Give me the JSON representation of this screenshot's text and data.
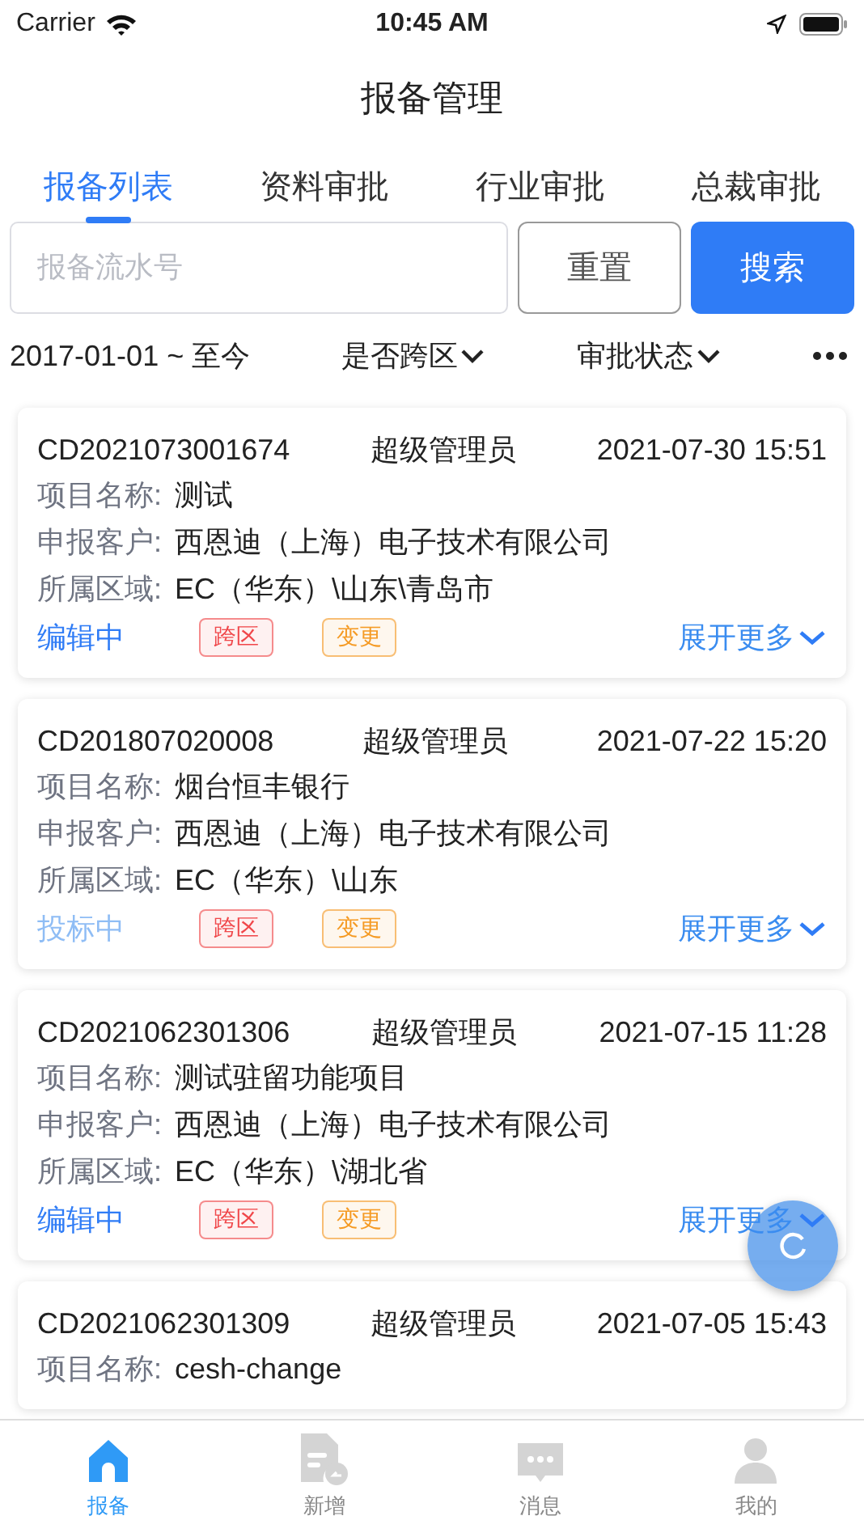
{
  "status_bar": {
    "carrier": "Carrier",
    "time": "10:45 AM"
  },
  "title": "报备管理",
  "tabs": [
    {
      "label": "报备列表",
      "selected": true
    },
    {
      "label": "资料审批",
      "selected": false
    },
    {
      "label": "行业审批",
      "selected": false
    },
    {
      "label": "总裁审批",
      "selected": false
    }
  ],
  "search": {
    "placeholder": "报备流水号",
    "reset": "重置",
    "submit": "搜索"
  },
  "filters": {
    "date_range": "2017-01-01 ~ 至今",
    "cross_region": "是否跨区",
    "approval_status": "审批状态"
  },
  "cards": [
    {
      "serial": "CD2021073001674",
      "user": "超级管理员",
      "time": "2021-07-30 15:51",
      "fields": [
        {
          "label": "项目名称:",
          "value": "测试"
        },
        {
          "label": "申报客户:",
          "value": "西恩迪（上海）电子技术有限公司"
        },
        {
          "label": "所属区域:",
          "value": "EC（华东）\\山东\\青岛市"
        }
      ],
      "status": {
        "text": "编辑中",
        "color": "#2f7cf6"
      },
      "tags": [
        {
          "text": "跨区",
          "color": "#f0474a"
        },
        {
          "text": "变更",
          "color": "#f59a23"
        }
      ],
      "expand": "展开更多"
    },
    {
      "serial": "CD201807020008",
      "user": "超级管理员",
      "time": "2021-07-22 15:20",
      "fields": [
        {
          "label": "项目名称:",
          "value": "烟台恒丰银行"
        },
        {
          "label": "申报客户:",
          "value": "西恩迪（上海）电子技术有限公司"
        },
        {
          "label": "所属区域:",
          "value": "EC（华东）\\山东"
        }
      ],
      "status": {
        "text": "投标中",
        "color": "#8fbdf5"
      },
      "tags": [
        {
          "text": "跨区",
          "color": "#f0474a"
        },
        {
          "text": "变更",
          "color": "#f59a23"
        }
      ],
      "expand": "展开更多"
    },
    {
      "serial": "CD2021062301306",
      "user": "超级管理员",
      "time": "2021-07-15 11:28",
      "fields": [
        {
          "label": "项目名称:",
          "value": "测试驻留功能项目"
        },
        {
          "label": "申报客户:",
          "value": "西恩迪（上海）电子技术有限公司"
        },
        {
          "label": "所属区域:",
          "value": "EC（华东）\\湖北省"
        }
      ],
      "status": {
        "text": "编辑中",
        "color": "#2f7cf6"
      },
      "tags": [
        {
          "text": "跨区",
          "color": "#f0474a"
        },
        {
          "text": "变更",
          "color": "#f59a23"
        }
      ],
      "expand": "展开更多"
    },
    {
      "serial": "CD2021062301309",
      "user": "超级管理员",
      "time": "2021-07-05 15:43",
      "fields": [
        {
          "label": "项目名称:",
          "value": "cesh-change"
        }
      ]
    }
  ],
  "bottom_tabs": [
    {
      "label": "报备",
      "kind": "home",
      "selected": true
    },
    {
      "label": "新增",
      "kind": "add",
      "selected": false
    },
    {
      "label": "消息",
      "kind": "message",
      "selected": false
    },
    {
      "label": "我的",
      "kind": "profile",
      "selected": false
    }
  ]
}
